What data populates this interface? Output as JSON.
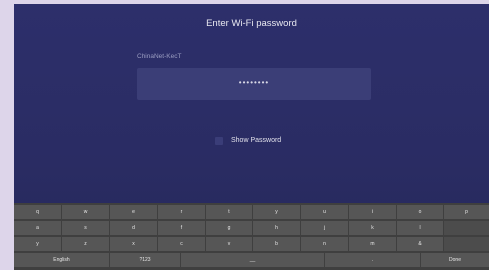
{
  "dialog": {
    "title": "Enter Wi-Fi password",
    "network_name": "ChinaNet-KecT",
    "password_masked": "••••••••",
    "show_password_label": "Show Password"
  },
  "keyboard": {
    "row1": [
      "q",
      "w",
      "e",
      "r",
      "t",
      "y",
      "u",
      "i",
      "o",
      "p"
    ],
    "row2": [
      "a",
      "s",
      "d",
      "f",
      "g",
      "h",
      "j",
      "k",
      "l"
    ],
    "row3": [
      "y",
      "z",
      "x",
      "c",
      "v",
      "b",
      "n",
      "m",
      "&"
    ],
    "row4": {
      "lang": "English",
      "symbols": "?123",
      "space": "__",
      "period": ".",
      "done": "Done"
    }
  }
}
